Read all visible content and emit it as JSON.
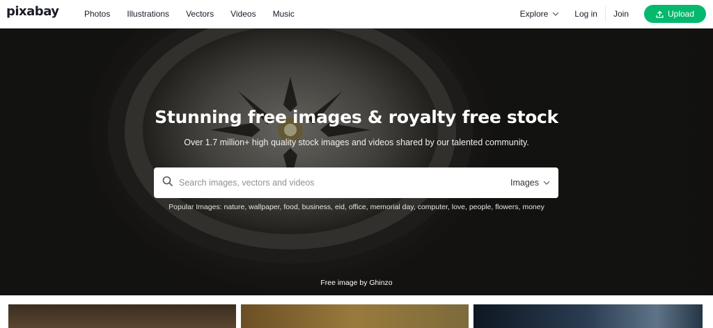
{
  "brand": {
    "logo_text": "pixabay"
  },
  "nav": {
    "items": [
      "Photos",
      "Illustrations",
      "Vectors",
      "Videos",
      "Music"
    ],
    "explore_label": "Explore",
    "login_label": "Log in",
    "join_label": "Join",
    "upload_label": "Upload"
  },
  "hero": {
    "title": "Stunning free images & royalty free stock",
    "subtitle": "Over 1.7 million+ high quality stock images and videos shared by our talented community.",
    "search_placeholder": "Search images, vectors and videos",
    "search_type": "Images",
    "popular_label": "Popular Images:",
    "popular_tags": [
      "nature",
      "wallpaper",
      "food",
      "business",
      "eid",
      "office",
      "memorial day",
      "computer",
      "love",
      "people",
      "flowers",
      "money"
    ],
    "credit": "Free image by Ghinzo"
  },
  "colors": {
    "accent": "#04b96d",
    "text": "#191b26"
  },
  "icons": {
    "search": "search-icon",
    "chevron": "chevron-down-icon",
    "upload": "upload-icon"
  }
}
